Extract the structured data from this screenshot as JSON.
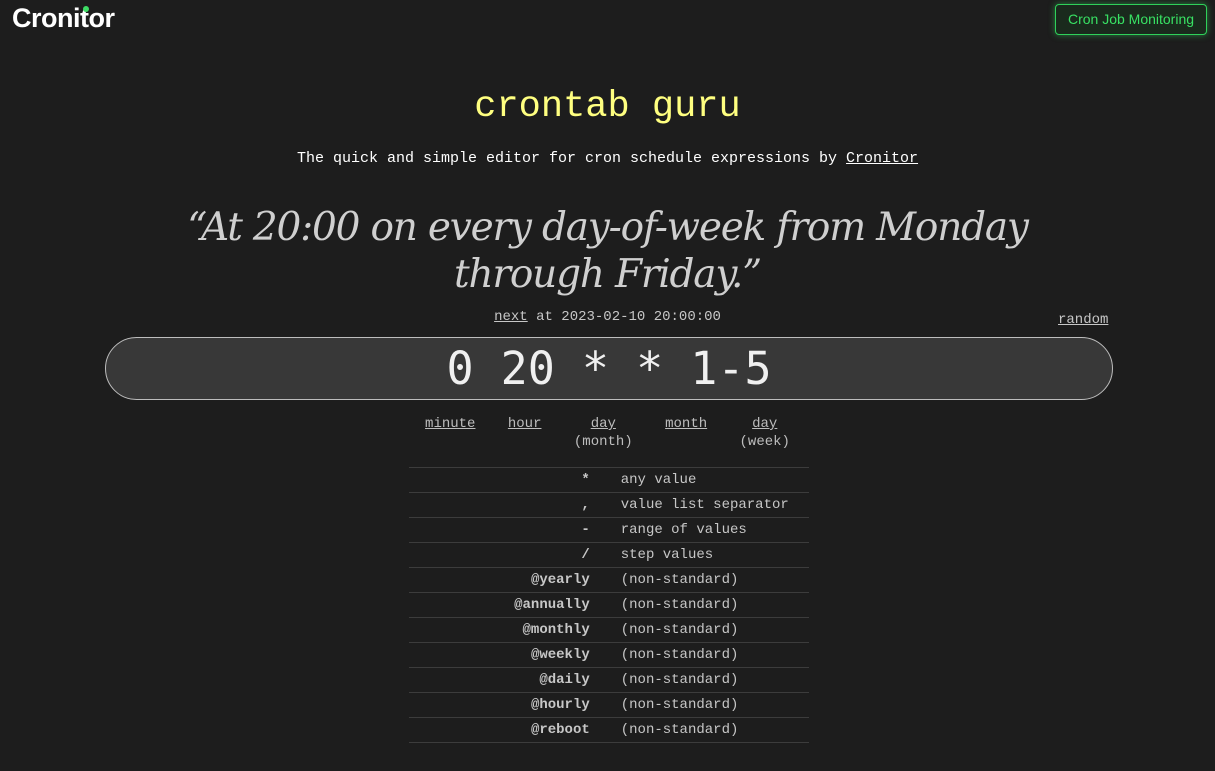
{
  "header": {
    "logo_text": "Cronitor",
    "cta_label": "Cron Job Monitoring"
  },
  "title": "crontab guru",
  "tagline": {
    "text": "The quick and simple editor for cron schedule expressions by ",
    "link_text": "Cronitor"
  },
  "description": "“At 20:00 on every day-of-week from Monday through Friday.”",
  "next_run": {
    "link_text": "next",
    "text": " at 2023-02-10 20:00:00"
  },
  "random_label": "random",
  "expression": "0 20 * * 1-5",
  "fields": [
    {
      "label": "minute",
      "sub": ""
    },
    {
      "label": "hour",
      "sub": ""
    },
    {
      "label": "day",
      "sub": "(month)"
    },
    {
      "label": "month",
      "sub": ""
    },
    {
      "label": "day",
      "sub": "(week)"
    }
  ],
  "syntax": [
    {
      "symbol": "*",
      "description": "any value"
    },
    {
      "symbol": ",",
      "description": "value list separator"
    },
    {
      "symbol": "-",
      "description": "range of values"
    },
    {
      "symbol": "/",
      "description": "step values"
    },
    {
      "symbol": "@yearly",
      "description": "(non-standard)"
    },
    {
      "symbol": "@annually",
      "description": "(non-standard)"
    },
    {
      "symbol": "@monthly",
      "description": "(non-standard)"
    },
    {
      "symbol": "@weekly",
      "description": "(non-standard)"
    },
    {
      "symbol": "@daily",
      "description": "(non-standard)"
    },
    {
      "symbol": "@hourly",
      "description": "(non-standard)"
    },
    {
      "symbol": "@reboot",
      "description": "(non-standard)"
    }
  ],
  "colors": {
    "background": "#1d1d1d",
    "title": "#ffff80",
    "accent_green": "#38e063",
    "input_background": "#383838"
  }
}
